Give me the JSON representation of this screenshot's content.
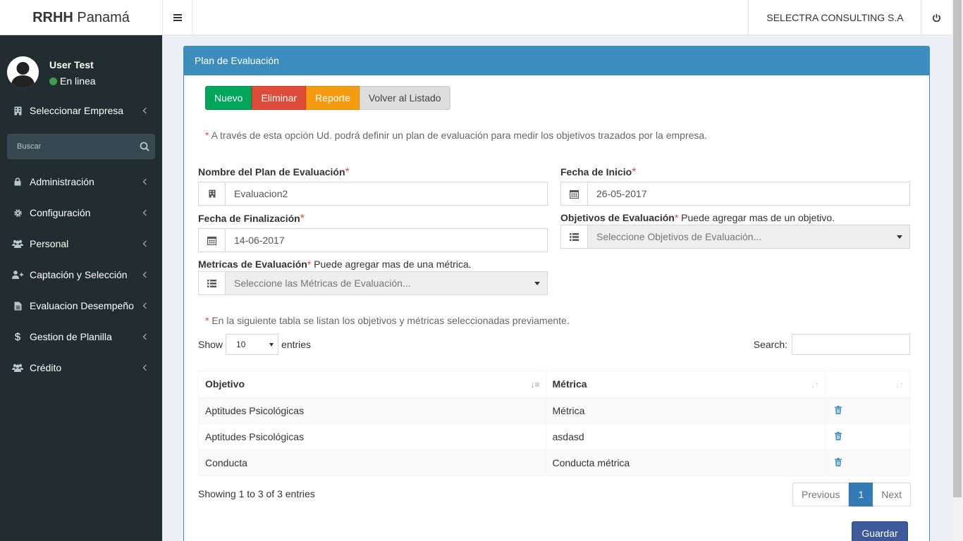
{
  "header": {
    "logo_bold": "RRHH",
    "logo_rest": " Panamá",
    "company": "SELECTRA CONSULTING S.A"
  },
  "sidebar": {
    "user_name": "User Test",
    "user_status": "En linea",
    "search_placeholder": "Buscar",
    "items": [
      {
        "label": "Seleccionar Empresa",
        "icon": "building-icon"
      },
      {
        "label": "Administración",
        "icon": "lock-icon"
      },
      {
        "label": "Configuración",
        "icon": "gear-icon"
      },
      {
        "label": "Personal",
        "icon": "users-icon"
      },
      {
        "label": "Captación y Selección",
        "icon": "user-plus-icon"
      },
      {
        "label": "Evaluacion Desempeño",
        "icon": "file-icon"
      },
      {
        "label": "Gestion de Planilla",
        "icon": "dollar-icon"
      },
      {
        "label": "Crédito",
        "icon": "users-icon"
      }
    ]
  },
  "panel": {
    "title": "Plan de Evaluación",
    "buttons": {
      "new": "Nuevo",
      "delete": "Eliminar",
      "report": "Reporte",
      "back": "Volver al Listado"
    },
    "note1": " A través de esta opción Ud. podrá definir un plan de evaluación para medir los objetivos trazados por la empresa.",
    "note2": " En la siguiente tabla se listan los objetivos y métricas seleccionadas previamente.",
    "form": {
      "plan_name_label": "Nombre del Plan de Evaluación",
      "plan_name_value": "Evaluacion2",
      "start_date_label": "Fecha de Inicio",
      "start_date_value": "26-05-2017",
      "end_date_label": "Fecha de Finalización",
      "end_date_value": "14-06-2017",
      "objectives_label": "Objetivos de Evaluación",
      "objectives_hint": " Puede agregar mas de un objetivo.",
      "objectives_placeholder": "Seleccione Objetivos de Evaluación...",
      "metrics_label": "Metricas de Evaluación",
      "metrics_hint": " Puede agregar mas de una métrica.",
      "metrics_placeholder": "Seleccione las Métricas de Evaluación...",
      "required_mark": "*"
    },
    "table": {
      "show_label": "Show",
      "entries_label": "entries",
      "page_size": "10",
      "search_label": "Search:",
      "headers": [
        "Objetivo",
        "Métrica"
      ],
      "rows": [
        {
          "objetivo": "Aptitudes Psicológicas",
          "metrica": "Métrica"
        },
        {
          "objetivo": "Aptitudes Psicológicas",
          "metrica": "asdasd"
        },
        {
          "objetivo": "Conducta",
          "metrica": "Conducta métrica"
        }
      ],
      "info": "Showing 1 to 3 of 3 entries",
      "prev": "Previous",
      "current_page": "1",
      "next": "Next"
    },
    "save": "Guardar"
  },
  "colors": {
    "primary": "#3c8dbc",
    "sidebar_bg": "#222d32",
    "success": "#00a65a",
    "danger": "#dd4b39",
    "warning": "#f39c12"
  }
}
